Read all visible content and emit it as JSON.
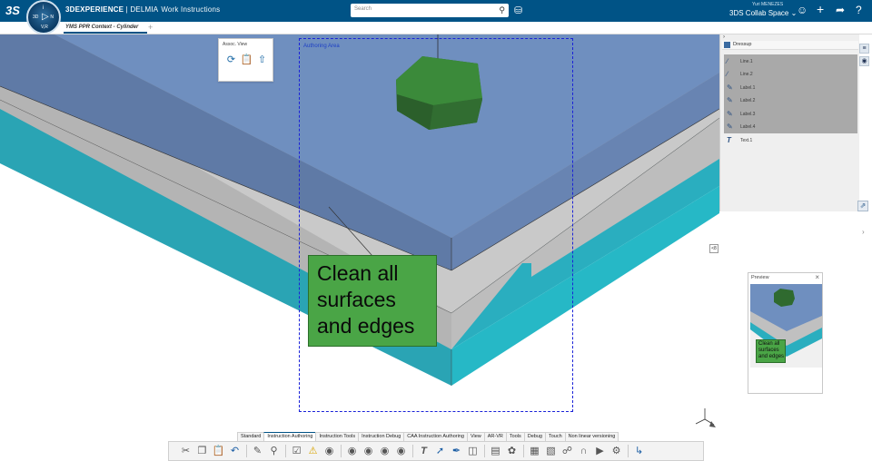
{
  "topbar": {
    "logo": "3S",
    "brand_prefix": "3DEXPERIENCE",
    "brand_suffix": " | DELMIA",
    "app_name": "Work Instructions",
    "compass": {
      "top": "i",
      "left": "3D",
      "right": "N",
      "bottom": "V,R",
      "center": "▷"
    },
    "search_placeholder": "Search",
    "user_name": "Yuri MENEZES",
    "collab_space": "3DS Collab Space",
    "icons": [
      "search-icon",
      "tag-icon",
      "user-icon",
      "add-icon",
      "share-icon",
      "help-icon"
    ]
  },
  "tab": {
    "label": "YMS PPR Context - Cylinder",
    "add": "+"
  },
  "viewport": {
    "authoring_label": "Authoring Area",
    "note_text": "Clean all surfaces and edges",
    "mini_tag": "<8"
  },
  "assoc_view": {
    "title": "Assoc. View"
  },
  "dressup": {
    "title": "Dressup",
    "items": [
      {
        "label": "Line.1",
        "icon": "line-icon",
        "selected": true
      },
      {
        "label": "Line.2",
        "icon": "line-icon",
        "selected": true
      },
      {
        "label": "Label.1",
        "icon": "label-icon",
        "selected": true
      },
      {
        "label": "Label.2",
        "icon": "label-icon",
        "selected": true
      },
      {
        "label": "Label.3",
        "icon": "label-icon",
        "selected": true
      },
      {
        "label": "Label.4",
        "icon": "label-icon",
        "selected": true
      },
      {
        "label": "Text.1",
        "icon": "text-icon",
        "selected": false
      }
    ]
  },
  "preview": {
    "title": "Preview",
    "close": "×",
    "note_text": "Clean all surfaces and edges"
  },
  "action_bar": {
    "tabs": [
      "Standard",
      "Instruction Authoring",
      "Instruction Tools",
      "Instruction Debug",
      "CAA Instruction Authoring",
      "View",
      "AR-VR",
      "Tools",
      "Debug",
      "Touch",
      "Non linear versioning"
    ],
    "active_tab": "Instruction Authoring"
  },
  "colors": {
    "topbar": "#005386",
    "note_green": "#4aa546",
    "authoring_border": "#1a22d8",
    "teal": "#2aaebf",
    "blue_top": "#6f8fbf",
    "grey_plate": "#b4b4b4"
  }
}
